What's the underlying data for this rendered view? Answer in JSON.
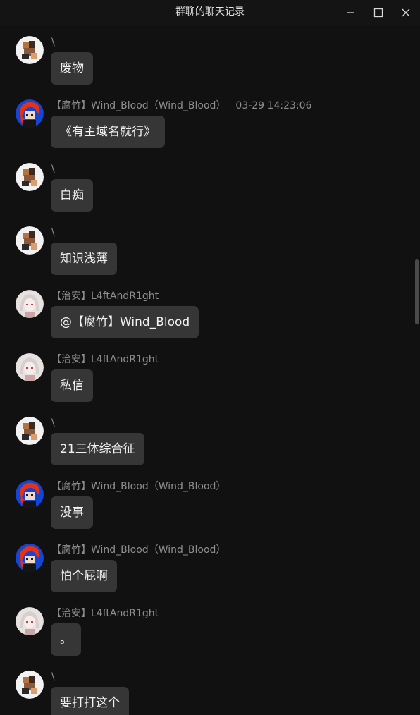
{
  "window": {
    "title": "群聊的聊天记录"
  },
  "messages": [
    {
      "avatar": "cat-avatar",
      "sender": "\\",
      "timestamp": "",
      "text": "废物"
    },
    {
      "avatar": "red-hair-avatar",
      "sender": "【腐竹】Wind_Blood（Wind_Blood）",
      "timestamp": "03-29 14:23:06",
      "text": "《有主域名就行》"
    },
    {
      "avatar": "cat-avatar",
      "sender": "\\",
      "timestamp": "",
      "text": "白痴"
    },
    {
      "avatar": "cat-avatar",
      "sender": "\\",
      "timestamp": "",
      "text": "知识浅薄"
    },
    {
      "avatar": "anime-girl-avatar",
      "sender": "【治安】L4ftAndR1ght",
      "timestamp": "",
      "text": "@【腐竹】Wind_Blood"
    },
    {
      "avatar": "anime-girl-avatar",
      "sender": "【治安】L4ftAndR1ght",
      "timestamp": "",
      "text": "私信"
    },
    {
      "avatar": "cat-avatar",
      "sender": "\\",
      "timestamp": "",
      "text": "21三体综合征"
    },
    {
      "avatar": "red-hair-avatar",
      "sender": "【腐竹】Wind_Blood（Wind_Blood）",
      "timestamp": "",
      "text": "没事"
    },
    {
      "avatar": "red-hair-avatar",
      "sender": "【腐竹】Wind_Blood（Wind_Blood）",
      "timestamp": "",
      "text": "怕个屁啊"
    },
    {
      "avatar": "anime-girl-avatar",
      "sender": "【治安】L4ftAndR1ght",
      "timestamp": "",
      "text": "。"
    },
    {
      "avatar": "cat-avatar",
      "sender": "\\",
      "timestamp": "",
      "text": "要打打这个"
    }
  ]
}
